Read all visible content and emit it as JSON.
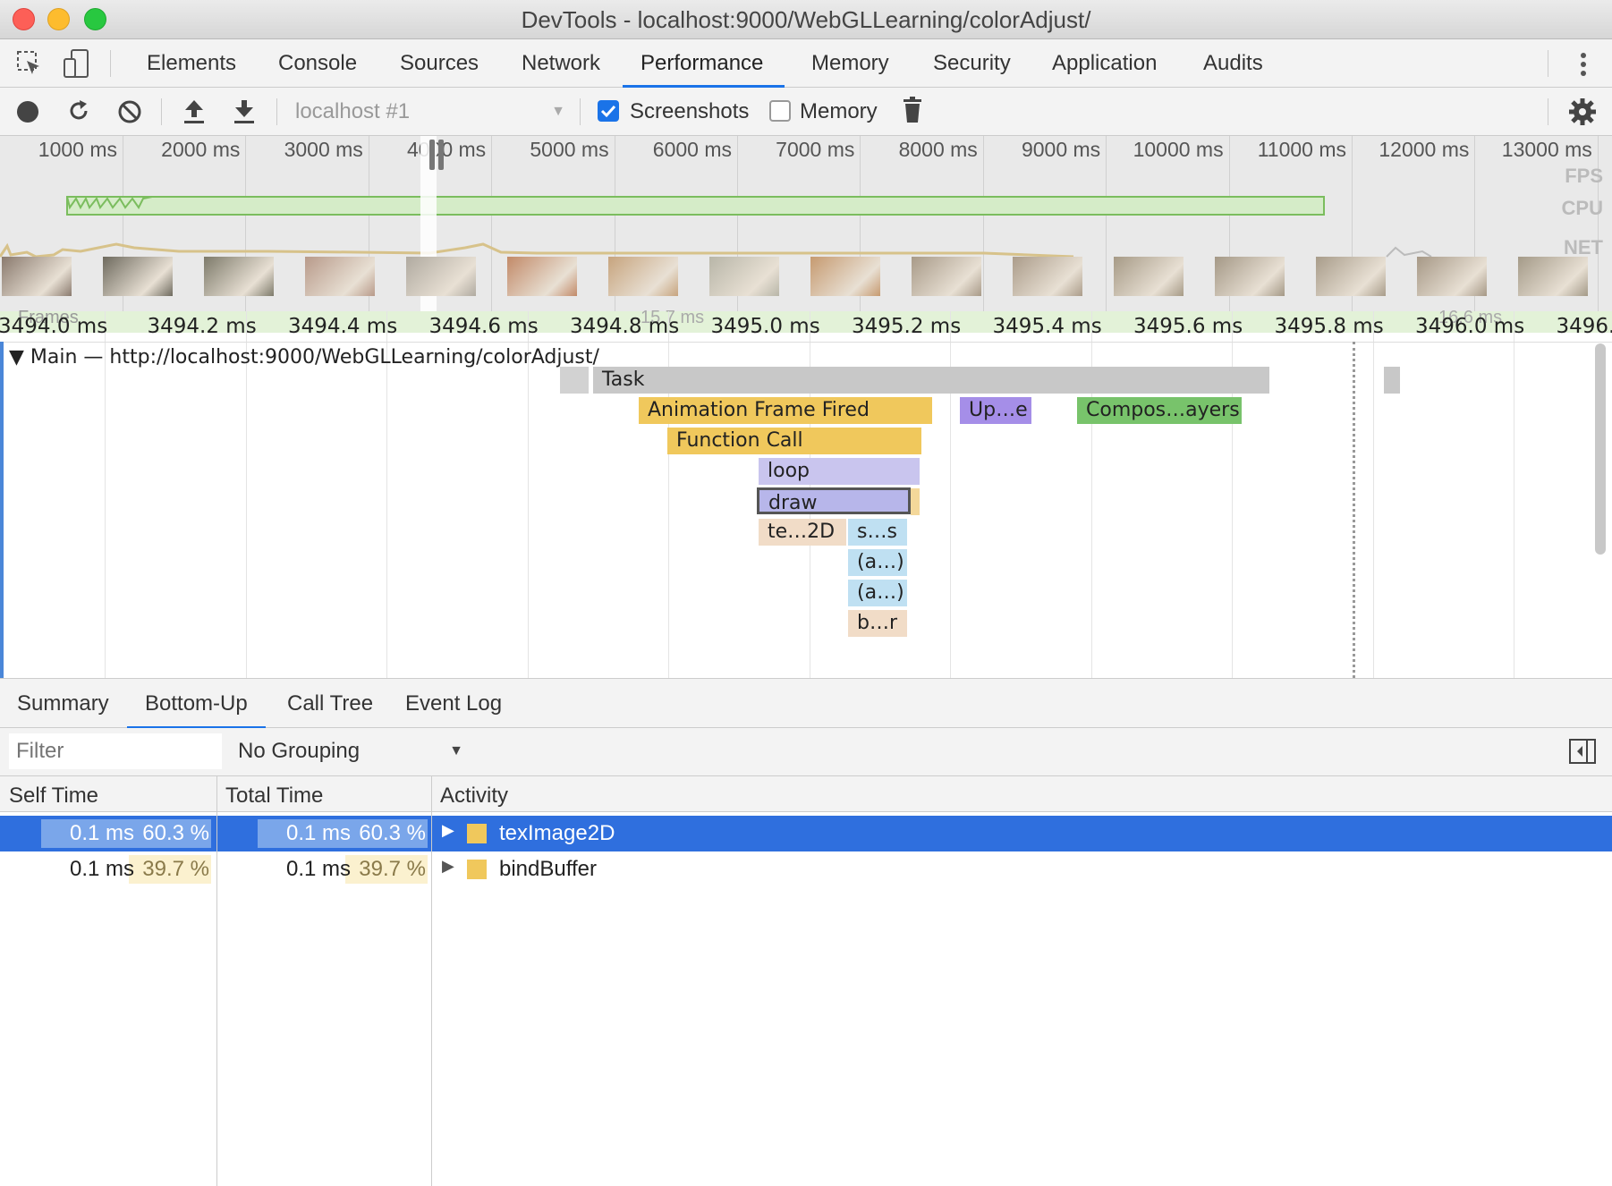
{
  "window": {
    "title": "DevTools - localhost:9000/WebGLLearning/colorAdjust/"
  },
  "tabs": [
    "Elements",
    "Console",
    "Sources",
    "Network",
    "Performance",
    "Memory",
    "Security",
    "Application",
    "Audits"
  ],
  "active_tab": "Performance",
  "toolbar": {
    "profile_select": "localhost #1",
    "screenshots_label": "Screenshots",
    "screenshots_checked": true,
    "memory_label": "Memory",
    "memory_checked": false
  },
  "overview": {
    "ticks": [
      "1000 ms",
      "2000 ms",
      "3000 ms",
      "4000 ms",
      "5000 ms",
      "6000 ms",
      "7000 ms",
      "8000 ms",
      "9000 ms",
      "10000 ms",
      "11000 ms",
      "12000 ms",
      "13000 ms"
    ],
    "tracks": [
      "FPS",
      "CPU",
      "NET"
    ]
  },
  "flamechart": {
    "ruler": [
      "3494.0 ms",
      "3494.2 ms",
      "3494.4 ms",
      "3494.6 ms",
      "3494.8 ms",
      "3495.0 ms",
      "3495.2 ms",
      "3495.4 ms",
      "3495.6 ms",
      "3495.8 ms",
      "3496.0 ms",
      "3496."
    ],
    "frames_label": "Frames",
    "frame_durations": [
      "15.7 ms",
      "16.6 ms"
    ],
    "main_label": "Main — http://localhost:9000/WebGLLearning/colorAdjust/",
    "events": {
      "task": "Task",
      "animation_frame": "Animation Frame Fired",
      "update": "Up…e",
      "composite": "Compos…ayers",
      "function_call": "Function Call",
      "loop": "loop",
      "draw": "draw",
      "teximage": "te…2D",
      "ss": "s…s",
      "a1": "(a…)",
      "a2": "(a…)",
      "br": "b…r"
    }
  },
  "bottom_tabs": [
    "Summary",
    "Bottom-Up",
    "Call Tree",
    "Event Log"
  ],
  "active_bottom_tab": "Bottom-Up",
  "filter": {
    "placeholder": "Filter",
    "grouping": "No Grouping"
  },
  "table": {
    "headers": [
      "Self Time",
      "Total Time",
      "Activity"
    ],
    "rows": [
      {
        "self_time": "0.1 ms",
        "self_pct": "60.3 %",
        "total_time": "0.1 ms",
        "total_pct": "60.3 %",
        "activity": "texImage2D",
        "selected": true
      },
      {
        "self_time": "0.1 ms",
        "self_pct": "39.7 %",
        "total_time": "0.1 ms",
        "total_pct": "39.7 %",
        "activity": "bindBuffer",
        "selected": false
      }
    ]
  },
  "colors": {
    "accent": "#1a73e8",
    "selected_row": "#2f6fde",
    "scripting": "#f0c85c",
    "rendering": "#a58ee8",
    "painting": "#78c36b",
    "task": "#c8c8c8"
  }
}
